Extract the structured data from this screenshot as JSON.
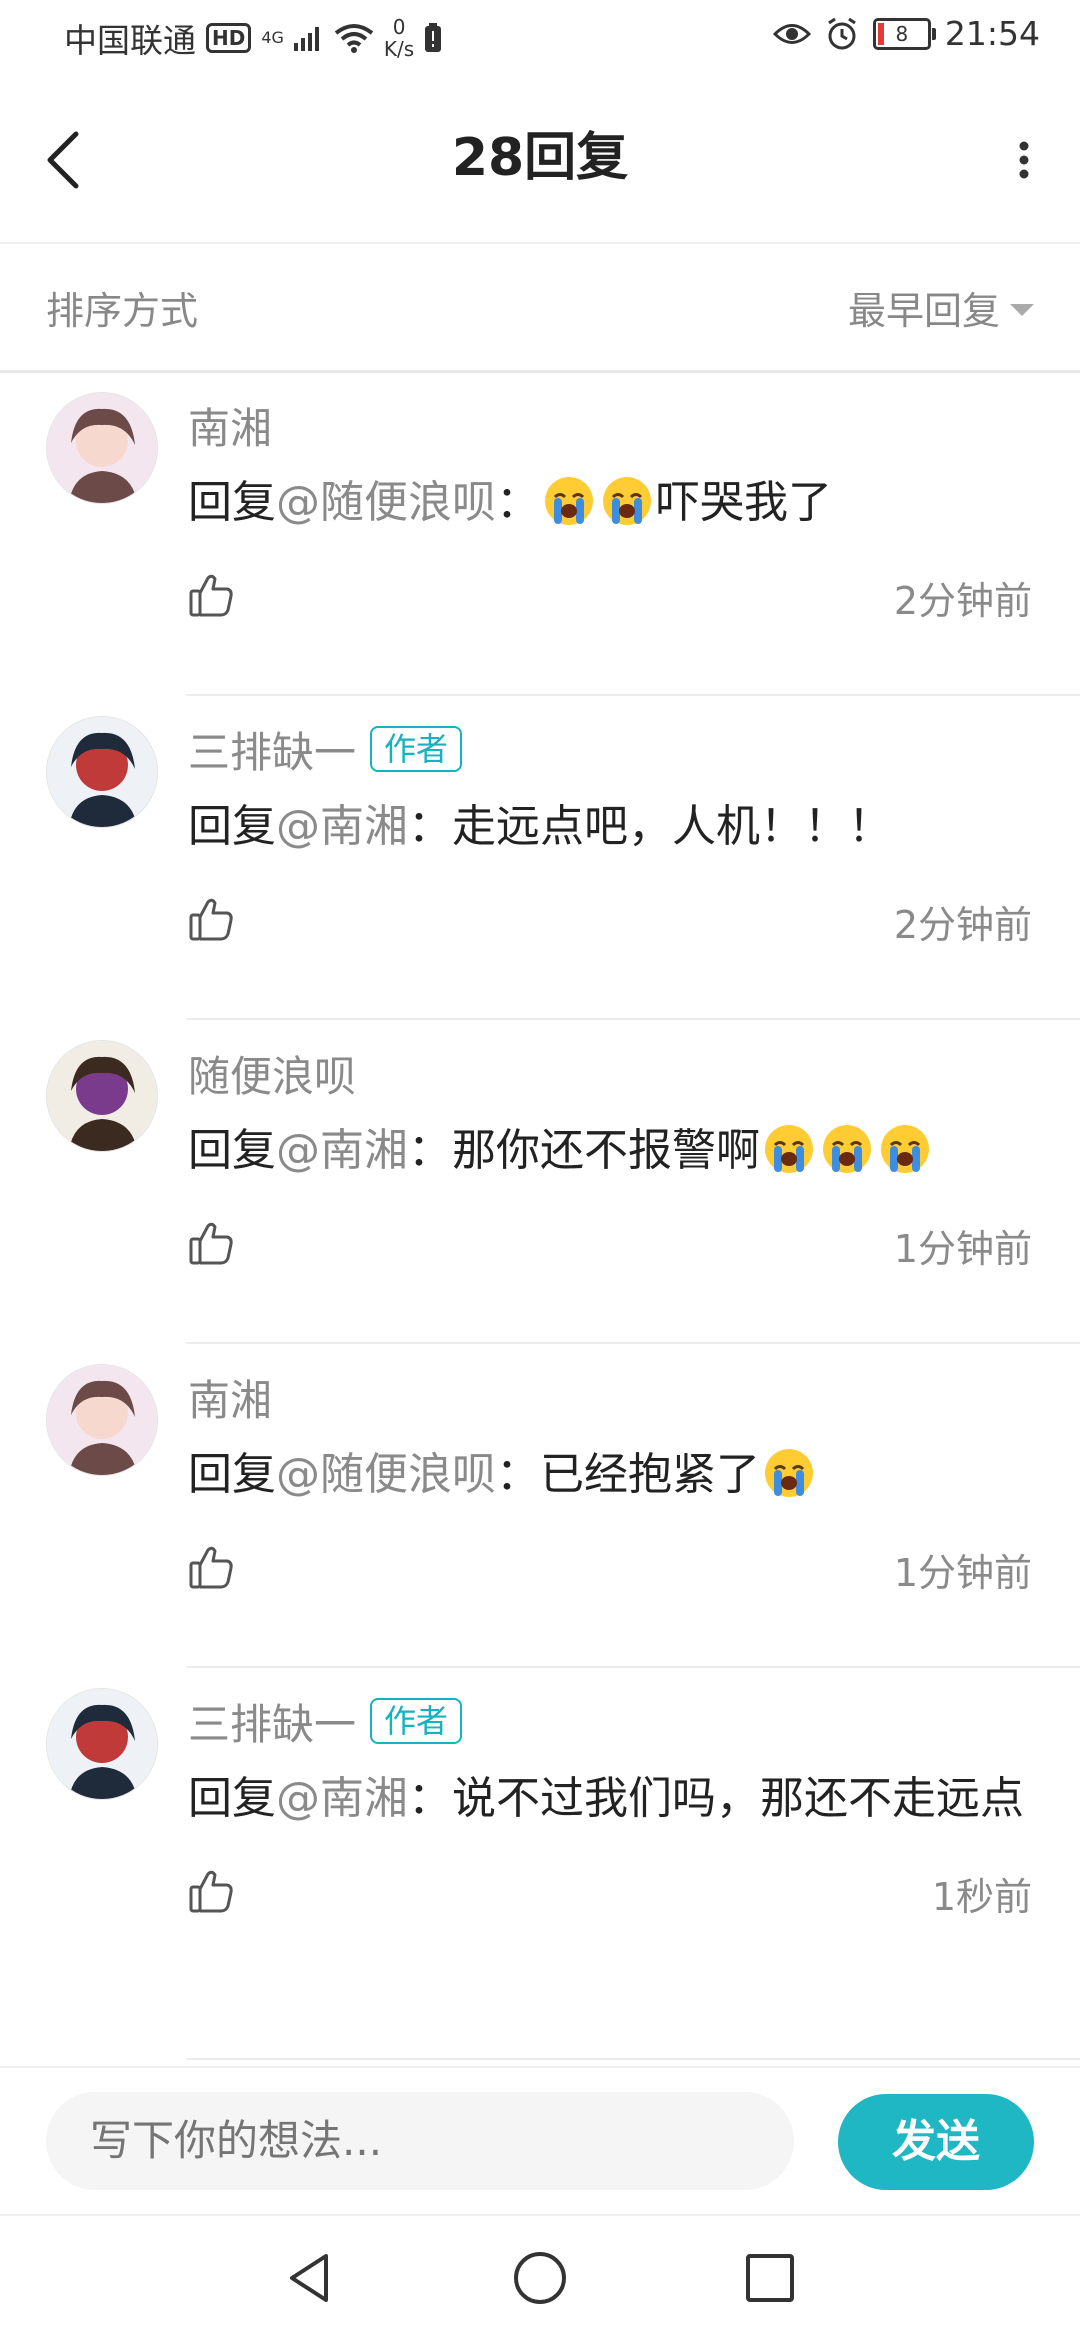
{
  "status_bar": {
    "carrier": "中国联通",
    "hd": "HD",
    "network": "4G",
    "speed_value": "0",
    "speed_unit": "K/s",
    "battery": "8",
    "time": "21:54"
  },
  "header": {
    "title": "28回复"
  },
  "sort": {
    "label": "排序方式",
    "selected": "最早回复"
  },
  "comments": [
    {
      "username": "南湘",
      "is_author": false,
      "content_prefix": "回复",
      "mention": "@随便浪呗",
      "content_suffix": "：",
      "emoji_before": 2,
      "content_after": "吓哭我了",
      "emoji_after": 0,
      "time": "2分钟前"
    },
    {
      "username": "三排缺一",
      "is_author": true,
      "author_badge": "作者",
      "content_prefix": "回复",
      "mention": "@南湘",
      "content_suffix": "：",
      "emoji_before": 0,
      "content_after": "走远点吧，人机！！！",
      "emoji_after": 0,
      "time": "2分钟前"
    },
    {
      "username": "随便浪呗",
      "is_author": false,
      "content_prefix": "回复",
      "mention": "@南湘",
      "content_suffix": "：",
      "emoji_before": 0,
      "content_after": "那你还不报警啊",
      "emoji_after": 3,
      "time": "1分钟前"
    },
    {
      "username": "南湘",
      "is_author": false,
      "content_prefix": "回复",
      "mention": "@随便浪呗",
      "content_suffix": "：",
      "emoji_before": 0,
      "content_after": "已经抱紧了",
      "emoji_after": 1,
      "time": "1分钟前"
    },
    {
      "username": "三排缺一",
      "is_author": true,
      "author_badge": "作者",
      "content_prefix": "回复",
      "mention": "@南湘",
      "content_suffix": "：",
      "emoji_before": 0,
      "content_after": "说不过我们吗，那还不走远点",
      "emoji_after": 0,
      "time": "1秒前"
    }
  ],
  "input": {
    "placeholder": "写下你的想法..."
  },
  "send_button": "发送",
  "colors": {
    "accent": "#1fb7c4",
    "muted_text": "#8a8a8a",
    "primary_text": "#222222"
  }
}
